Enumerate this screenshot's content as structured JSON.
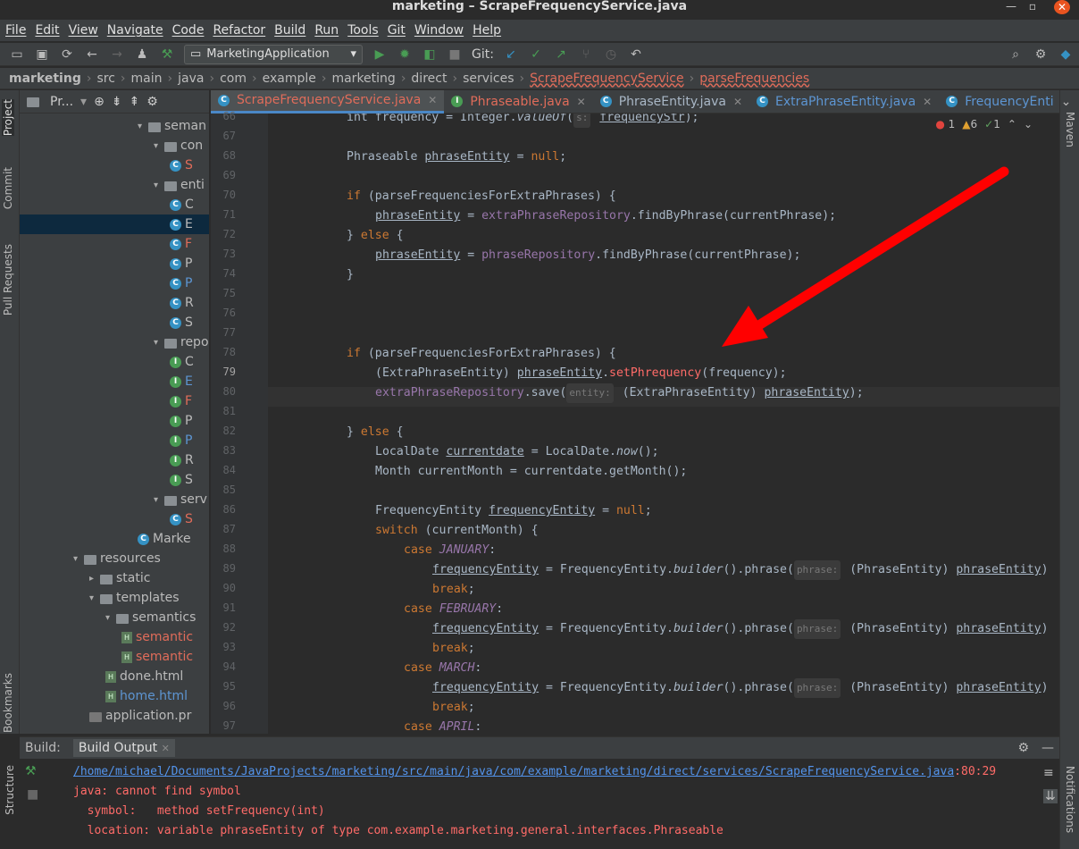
{
  "window": {
    "title": "marketing – ScrapeFrequencyService.java"
  },
  "menu": [
    "File",
    "Edit",
    "View",
    "Navigate",
    "Code",
    "Refactor",
    "Build",
    "Run",
    "Tools",
    "Git",
    "Window",
    "Help"
  ],
  "toolbar": {
    "run_config": "MarketingApplication",
    "git_label": "Git:"
  },
  "breadcrumb": [
    "marketing",
    "src",
    "main",
    "java",
    "com",
    "example",
    "marketing",
    "direct",
    "services",
    "ScrapeFrequencyService",
    "parseFrequencies"
  ],
  "project": {
    "header": "Pr...",
    "tree": [
      {
        "label": "seman",
        "depth": 7,
        "type": "folder",
        "open": true
      },
      {
        "label": "con",
        "depth": 8,
        "type": "folder",
        "open": true
      },
      {
        "label": "S",
        "depth": 9,
        "type": "class",
        "color": "#e06c5a"
      },
      {
        "label": "enti",
        "depth": 8,
        "type": "folder",
        "open": true
      },
      {
        "label": "C",
        "depth": 9,
        "type": "class"
      },
      {
        "label": "E",
        "depth": 9,
        "type": "class",
        "selected": true
      },
      {
        "label": "F",
        "depth": 9,
        "type": "class",
        "color": "#e06c5a"
      },
      {
        "label": "P",
        "depth": 9,
        "type": "class"
      },
      {
        "label": "P",
        "depth": 9,
        "type": "class",
        "color": "#5d95d2"
      },
      {
        "label": "R",
        "depth": 9,
        "type": "class"
      },
      {
        "label": "S",
        "depth": 9,
        "type": "class"
      },
      {
        "label": "repo",
        "depth": 8,
        "type": "folder",
        "open": true
      },
      {
        "label": "C",
        "depth": 9,
        "type": "iface"
      },
      {
        "label": "E",
        "depth": 9,
        "type": "iface",
        "color": "#5d95d2"
      },
      {
        "label": "F",
        "depth": 9,
        "type": "iface",
        "color": "#e06c5a"
      },
      {
        "label": "P",
        "depth": 9,
        "type": "iface"
      },
      {
        "label": "P",
        "depth": 9,
        "type": "iface",
        "color": "#5d95d2"
      },
      {
        "label": "R",
        "depth": 9,
        "type": "iface"
      },
      {
        "label": "S",
        "depth": 9,
        "type": "iface"
      },
      {
        "label": "serv",
        "depth": 8,
        "type": "folder",
        "open": true
      },
      {
        "label": "S",
        "depth": 9,
        "type": "class",
        "color": "#e06c5a"
      },
      {
        "label": "Marke",
        "depth": 7,
        "type": "class"
      },
      {
        "label": "resources",
        "depth": 3,
        "type": "folder",
        "open": true
      },
      {
        "label": "static",
        "depth": 4,
        "type": "folder"
      },
      {
        "label": "templates",
        "depth": 4,
        "type": "folder",
        "open": true
      },
      {
        "label": "semantics",
        "depth": 5,
        "type": "folder",
        "open": true
      },
      {
        "label": "semantic",
        "depth": 6,
        "type": "html",
        "color": "#e06c5a"
      },
      {
        "label": "semantic",
        "depth": 6,
        "type": "html",
        "color": "#e06c5a"
      },
      {
        "label": "done.html",
        "depth": 5,
        "type": "html"
      },
      {
        "label": "home.html",
        "depth": 5,
        "type": "html",
        "color": "#5d95d2"
      },
      {
        "label": "application.pr",
        "depth": 4,
        "type": "props"
      }
    ]
  },
  "tabs": [
    {
      "label": "ScrapeFrequencyService.java",
      "active": true,
      "color": "#e06c5a"
    },
    {
      "label": "Phraseable.java",
      "color": "#e06c5a"
    },
    {
      "label": "PhraseEntity.java",
      "color": "#a9b7c6"
    },
    {
      "label": "ExtraPhraseEntity.java",
      "color": "#5d95d2"
    },
    {
      "label": "FrequencyEnti",
      "color": "#5d95d2"
    }
  ],
  "inspection": {
    "errors": "1",
    "warnings": "6",
    "ok": "1"
  },
  "lines": [
    "66",
    "67",
    "68",
    "69",
    "70",
    "71",
    "72",
    "73",
    "74",
    "75",
    "76",
    "77",
    "78",
    "79",
    "80",
    "81",
    "82",
    "83",
    "84",
    "85",
    "86",
    "87",
    "88",
    "89",
    "90",
    "91",
    "92",
    "93",
    "94",
    "95",
    "96",
    "97"
  ],
  "build": {
    "label": "Build:",
    "tab": "Build Output",
    "path": "/home/michael/Documents/JavaProjects/marketing/src/main/java/com/example/marketing/direct/services/ScrapeFrequencyService.java",
    "pos": ":80:29",
    "msg1": "java: cannot find symbol",
    "msg2": "  symbol:   method setFrequency(int)",
    "msg3": "  location: variable phraseEntity of type com.example.marketing.general.interfaces.Phraseable"
  },
  "side": {
    "project": "Project",
    "commit": "Commit",
    "pull": "Pull Requests",
    "bookmarks": "Bookmarks",
    "structure": "Structure",
    "maven": "Maven",
    "notifications": "Notifications"
  },
  "colors": {
    "error": "#ff6b68",
    "keyword": "#cc7832",
    "field": "#9876aa",
    "arrow": "#ff0000"
  }
}
